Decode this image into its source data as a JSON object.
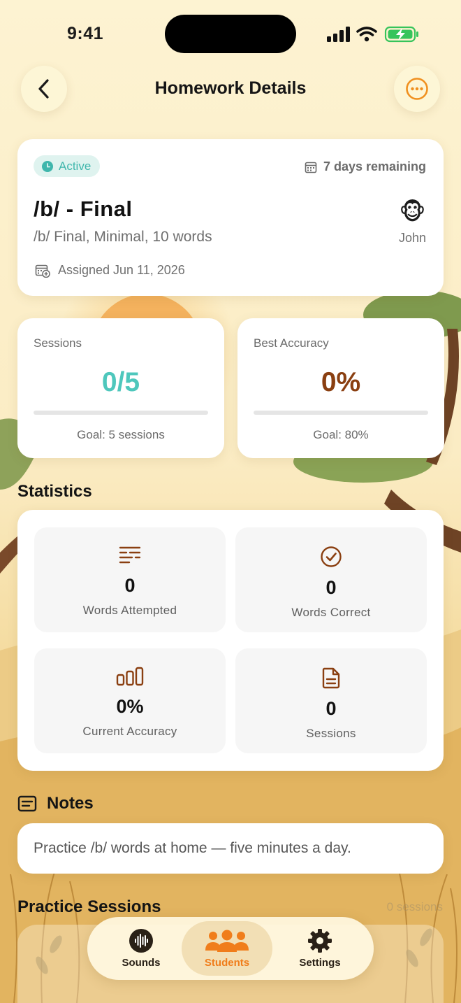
{
  "status_bar": {
    "time": "9:41"
  },
  "header": {
    "title": "Homework Details",
    "back_icon": "chevron-left-icon",
    "more_icon": "ellipsis-circle-icon"
  },
  "summary": {
    "status": "Active",
    "days_remaining": "7 days remaining",
    "title": "/b/ - Final",
    "subtitle": "/b/ Final, Minimal, 10 words",
    "assigned": "Assigned Jun 11, 2026",
    "student_name": "John",
    "student_avatar": "🐵"
  },
  "metrics": {
    "sessions": {
      "label": "Sessions",
      "value": "0/5",
      "goal": "Goal: 5 sessions",
      "progress": 0
    },
    "accuracy": {
      "label": "Best Accuracy",
      "value": "0%",
      "goal": "Goal: 80%",
      "progress": 0
    }
  },
  "statistics": {
    "title": "Statistics",
    "tiles": [
      {
        "value": "0",
        "label": "Words Attempted",
        "icon": "text-lines-icon"
      },
      {
        "value": "0",
        "label": "Words Correct",
        "icon": "check-circle-icon"
      },
      {
        "value": "0%",
        "label": "Current Accuracy",
        "icon": "bar-chart-icon"
      },
      {
        "value": "0",
        "label": "Sessions",
        "icon": "document-icon"
      }
    ]
  },
  "notes": {
    "title": "Notes",
    "text": "Practice /b/ words at home — five minutes a day."
  },
  "practice_sessions": {
    "title": "Practice Sessions",
    "count": "0 sessions"
  },
  "tabbar": {
    "tabs": [
      {
        "label": "Sounds",
        "icon": "waveform-icon"
      },
      {
        "label": "Students",
        "icon": "people-icon",
        "active": true
      },
      {
        "label": "Settings",
        "icon": "gear-icon"
      }
    ]
  },
  "colors": {
    "accent_teal": "#4ec7bc",
    "accent_brown": "#8a3f11",
    "accent_orange": "#f07d1b",
    "background": "#fbefc9"
  }
}
